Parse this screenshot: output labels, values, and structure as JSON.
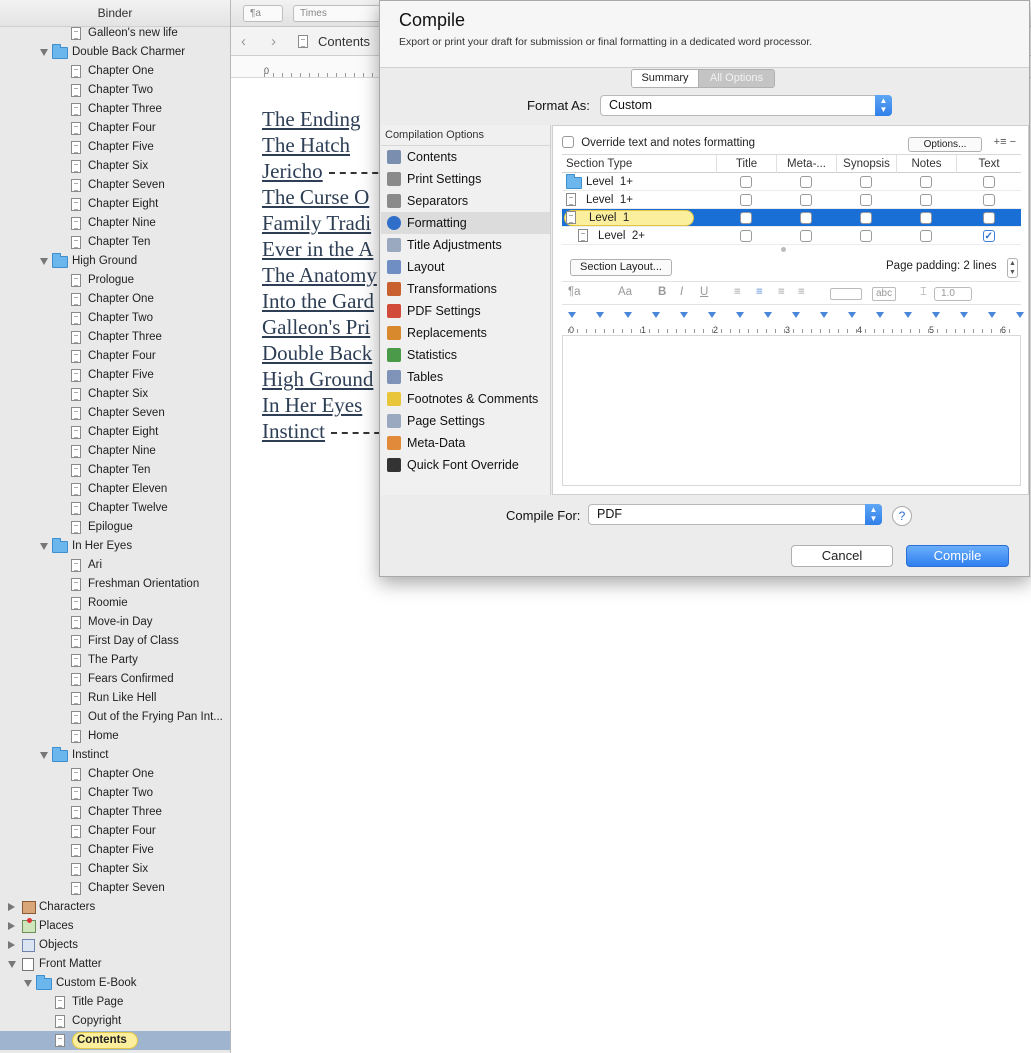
{
  "binder": {
    "title": "Binder",
    "items": [
      {
        "label": "Galleon's new life",
        "level": 2,
        "kind": "doc"
      },
      {
        "label": "Double Back Charmer",
        "level": 1,
        "kind": "folder",
        "open": true
      },
      {
        "label": "Chapter One",
        "level": 2,
        "kind": "doc"
      },
      {
        "label": "Chapter Two",
        "level": 2,
        "kind": "doc"
      },
      {
        "label": "Chapter Three",
        "level": 2,
        "kind": "doc"
      },
      {
        "label": "Chapter Four",
        "level": 2,
        "kind": "doc"
      },
      {
        "label": "Chapter Five",
        "level": 2,
        "kind": "doc"
      },
      {
        "label": "Chapter Six",
        "level": 2,
        "kind": "doc"
      },
      {
        "label": "Chapter Seven",
        "level": 2,
        "kind": "doc"
      },
      {
        "label": "Chapter Eight",
        "level": 2,
        "kind": "doc"
      },
      {
        "label": "Chapter Nine",
        "level": 2,
        "kind": "doc"
      },
      {
        "label": "Chapter Ten",
        "level": 2,
        "kind": "doc"
      },
      {
        "label": "High Ground",
        "level": 1,
        "kind": "folder",
        "open": true
      },
      {
        "label": "Prologue",
        "level": 2,
        "kind": "doc"
      },
      {
        "label": "Chapter One",
        "level": 2,
        "kind": "doc"
      },
      {
        "label": "Chapter Two",
        "level": 2,
        "kind": "doc"
      },
      {
        "label": "Chapter Three",
        "level": 2,
        "kind": "doc"
      },
      {
        "label": "Chapter Four",
        "level": 2,
        "kind": "doc"
      },
      {
        "label": "Chapter Five",
        "level": 2,
        "kind": "doc"
      },
      {
        "label": "Chapter Six",
        "level": 2,
        "kind": "doc"
      },
      {
        "label": "Chapter Seven",
        "level": 2,
        "kind": "doc"
      },
      {
        "label": "Chapter Eight",
        "level": 2,
        "kind": "doc"
      },
      {
        "label": "Chapter Nine",
        "level": 2,
        "kind": "doc"
      },
      {
        "label": "Chapter Ten",
        "level": 2,
        "kind": "doc"
      },
      {
        "label": "Chapter Eleven",
        "level": 2,
        "kind": "doc"
      },
      {
        "label": "Chapter Twelve",
        "level": 2,
        "kind": "doc"
      },
      {
        "label": "Epilogue",
        "level": 2,
        "kind": "doc"
      },
      {
        "label": "In Her Eyes",
        "level": 1,
        "kind": "folder",
        "open": true
      },
      {
        "label": "Ari",
        "level": 2,
        "kind": "doc"
      },
      {
        "label": "Freshman Orientation",
        "level": 2,
        "kind": "doc"
      },
      {
        "label": "Roomie",
        "level": 2,
        "kind": "doc"
      },
      {
        "label": "Move-in Day",
        "level": 2,
        "kind": "doc"
      },
      {
        "label": "First Day of Class",
        "level": 2,
        "kind": "doc"
      },
      {
        "label": "The Party",
        "level": 2,
        "kind": "doc"
      },
      {
        "label": "Fears Confirmed",
        "level": 2,
        "kind": "doc"
      },
      {
        "label": "Run Like Hell",
        "level": 2,
        "kind": "doc"
      },
      {
        "label": "Out of the Frying Pan Int...",
        "level": 2,
        "kind": "doc"
      },
      {
        "label": "Home",
        "level": 2,
        "kind": "doc"
      },
      {
        "label": "Instinct",
        "level": 1,
        "kind": "folder",
        "open": true
      },
      {
        "label": "Chapter One",
        "level": 2,
        "kind": "doc"
      },
      {
        "label": "Chapter Two",
        "level": 2,
        "kind": "doc"
      },
      {
        "label": "Chapter Three",
        "level": 2,
        "kind": "doc"
      },
      {
        "label": "Chapter Four",
        "level": 2,
        "kind": "doc"
      },
      {
        "label": "Chapter Five",
        "level": 2,
        "kind": "doc"
      },
      {
        "label": "Chapter Six",
        "level": 2,
        "kind": "doc"
      },
      {
        "label": "Chapter Seven",
        "level": 2,
        "kind": "doc"
      },
      {
        "label": "Characters",
        "level": 0,
        "kind": "characters",
        "open": false
      },
      {
        "label": "Places",
        "level": 0,
        "kind": "places",
        "open": false
      },
      {
        "label": "Objects",
        "level": 0,
        "kind": "objects",
        "open": false
      },
      {
        "label": "Front Matter",
        "level": 0,
        "kind": "frontmatter",
        "open": true
      },
      {
        "label": "Custom E-Book",
        "level": 1,
        "kind": "folder",
        "open": true
      },
      {
        "label": "Title Page",
        "level": 2,
        "kind": "doc"
      },
      {
        "label": "Copyright",
        "level": 2,
        "kind": "doc"
      },
      {
        "label": "Contents",
        "level": 2,
        "kind": "doc",
        "selected": true
      }
    ]
  },
  "editor": {
    "style_menu": "¶a",
    "font_menu": "Times",
    "nav_title": "Contents",
    "ruler_zero": "0",
    "toc": [
      "The Ending",
      "The Hatch",
      "Jericho",
      "The Curse O",
      "Family Tradi",
      "Ever in the A",
      "The Anatomy",
      "Into the Gard",
      "Galleon's Pri",
      "Double Back",
      "High Ground",
      "In Her Eyes",
      "Instinct"
    ]
  },
  "compile": {
    "title": "Compile",
    "description": "Export or print your draft for submission or final formatting in a dedicated word processor.",
    "tabs": {
      "summary": "Summary",
      "all_options": "All Options"
    },
    "format_as_label": "Format As:",
    "format_as_value": "Custom",
    "options_header": "Compilation Options",
    "options": [
      {
        "label": "Contents",
        "icon": "contents-icon",
        "color": "#7a8fb0"
      },
      {
        "label": "Print Settings",
        "icon": "printer-icon",
        "color": "#8a8a8a"
      },
      {
        "label": "Separators",
        "icon": "separators-icon",
        "color": "#8a8a8a"
      },
      {
        "label": "Formatting",
        "icon": "formatting-icon",
        "color": "#2f6fc9",
        "selected": true
      },
      {
        "label": "Title Adjustments",
        "icon": "title-adjustments-icon",
        "color": "#9aa8c0"
      },
      {
        "label": "Layout",
        "icon": "layout-icon",
        "color": "#6f8fc4"
      },
      {
        "label": "Transformations",
        "icon": "transformations-icon",
        "color": "#c9602f"
      },
      {
        "label": "PDF Settings",
        "icon": "pdf-icon",
        "color": "#d14a3a"
      },
      {
        "label": "Replacements",
        "icon": "replacements-icon",
        "color": "#d8892e"
      },
      {
        "label": "Statistics",
        "icon": "statistics-icon",
        "color": "#4a9a4a"
      },
      {
        "label": "Tables",
        "icon": "tables-icon",
        "color": "#7f93b8"
      },
      {
        "label": "Footnotes & Comments",
        "icon": "footnotes-icon",
        "color": "#e8c53b"
      },
      {
        "label": "Page Settings",
        "icon": "page-settings-icon",
        "color": "#9aa8c0"
      },
      {
        "label": "Meta-Data",
        "icon": "meta-data-icon",
        "color": "#e08a3a"
      },
      {
        "label": "Quick Font Override",
        "icon": "font-override-icon",
        "color": "#333333"
      }
    ],
    "override_label": "Override text and notes formatting",
    "options_button": "Options...",
    "plus_minus": "+≡ −",
    "table_headers": [
      "Section Type",
      "Title",
      "Meta-...",
      "Synopsis",
      "Notes",
      "Text"
    ],
    "rows": [
      {
        "name": "Level  1+",
        "icon": "folder",
        "checks": [
          false,
          false,
          false,
          false,
          false
        ]
      },
      {
        "name": "Level  1+",
        "icon": "doc-stack",
        "checks": [
          false,
          false,
          false,
          false,
          false
        ]
      },
      {
        "name": "Level  1",
        "icon": "doc",
        "checks": [
          false,
          false,
          false,
          false,
          false
        ],
        "selected": true
      },
      {
        "name": "Level  2+",
        "icon": "doc",
        "indent": true,
        "checks": [
          false,
          false,
          false,
          false,
          true
        ]
      }
    ],
    "section_layout_button": "Section Layout...",
    "page_padding": "Page padding: 2 lines",
    "tools": {
      "para": "¶a",
      "aa": "Aa",
      "bold": "B",
      "italic": "I",
      "underline": "U",
      "abc": "abc",
      "spacing": "1.0"
    },
    "ruler_numbers": [
      "0",
      "1",
      "2",
      "3",
      "4",
      "5",
      "6"
    ],
    "compile_for_label": "Compile For:",
    "compile_for_value": "PDF",
    "help": "?",
    "cancel": "Cancel",
    "compile_button": "Compile"
  }
}
